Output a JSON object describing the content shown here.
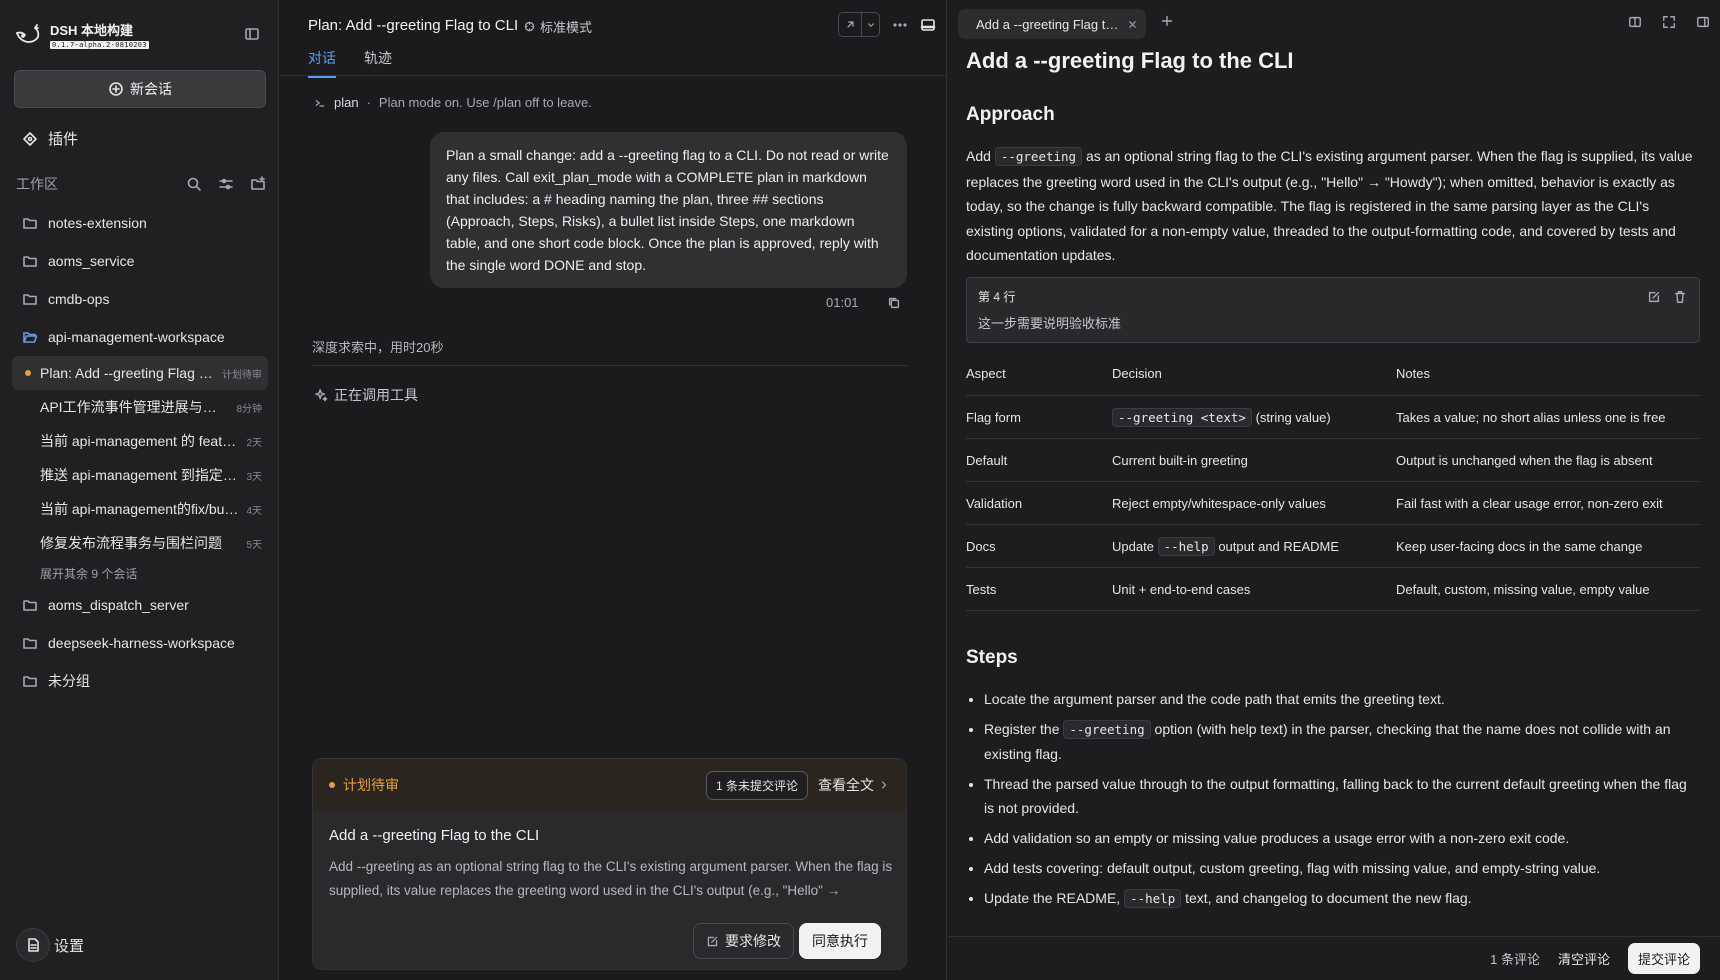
{
  "brand": {
    "name": "DSH 本地构建",
    "version": "0.1.7-alpha.2-0810203"
  },
  "sidebar": {
    "new_chat": "新会话",
    "plugins": "插件",
    "workspace_label": "工作区",
    "folders_top": [
      {
        "name": "notes-extension"
      },
      {
        "name": "aoms_service"
      },
      {
        "name": "cmdb-ops"
      },
      {
        "name": "api-management-workspace"
      }
    ],
    "sessions": [
      {
        "title": "Plan: Add --greeting Flag to CLI",
        "meta": "计划待审"
      },
      {
        "title": "API工作流事件管理进展与后续",
        "meta": "8分钟"
      },
      {
        "title": "当前 api-management 的 feature 分支",
        "meta": "2天"
      },
      {
        "title": "推送 api-management 到指定远程",
        "meta": "3天"
      },
      {
        "title": "当前 api-management的fix/bug分支",
        "meta": "4天"
      },
      {
        "title": "修复发布流程事务与围栏问题",
        "meta": "5天"
      }
    ],
    "expand_more": "展开其余 9 个会话",
    "folders_bottom": [
      {
        "name": "aoms_dispatch_server"
      },
      {
        "name": "deepseek-harness-workspace"
      },
      {
        "name": "未分组"
      }
    ],
    "settings": "设置"
  },
  "center": {
    "title": "Plan: Add --greeting Flag to CLI",
    "mode": "标准模式",
    "tabs": [
      {
        "label": "对话"
      },
      {
        "label": "轨迹"
      }
    ],
    "plan_tag": "plan",
    "plan_note": "Plan mode on. Use /plan off to leave.",
    "user_message": "Plan a small change: add a --greeting flag to a CLI. Do not read or write any files. Call exit_plan_mode with a COMPLETE plan in markdown that includes: a # heading naming the plan, three ## sections (Approach, Steps, Risks), a bullet list inside Steps, one markdown table, and one short code block. Once the plan is approved, reply with the single word DONE and stop.",
    "message_time": "01:01",
    "thinking": "深度求索中，用时20秒",
    "tool_status": "正在调用工具",
    "plan_card": {
      "status": "计划待审",
      "pending_comments": "1 条未提交评论",
      "view_full": "查看全文",
      "title": "Add a --greeting Flag to the CLI",
      "body": "Add --greeting as an optional string flag to the CLI's existing argument parser. When the flag is supplied, its value replaces the greeting word used in the CLI's output (e.g., \"Hello\" → \"Howdy\"); when omitted, behavior is exactly as today.",
      "request_changes": "要求修改",
      "approve": "同意执行"
    }
  },
  "right": {
    "tab_title": "Add a --greeting Flag to the CLI",
    "doc": {
      "h1": "Add a --greeting Flag to the CLI",
      "approach_heading": "Approach",
      "approach_pre": "Add",
      "approach_code": "--greeting",
      "approach_post": "as an optional string flag to the CLI's existing argument parser. When the flag is supplied, its value replaces the greeting word used in the CLI's output (e.g., \"Hello\" → \"Howdy\"); when omitted, behavior is exactly as today, so the change is fully backward compatible. The flag is registered in the same parsing layer as the CLI's existing options, validated for a non-empty value, threaded to the output-formatting code, and covered by tests and documentation updates.",
      "comment": {
        "line": "第 4 行",
        "text": "这一步需要说明验收标准"
      },
      "table": {
        "headers": [
          "Aspect",
          "Decision",
          "Notes"
        ],
        "rows": [
          {
            "aspect": "Flag form",
            "code": "--greeting <text>",
            "decision": "(string value)",
            "notes": "Takes a value; no short alias unless one is free"
          },
          {
            "aspect": "Default",
            "decision": "Current built-in greeting",
            "notes": "Output is unchanged when the flag is absent"
          },
          {
            "aspect": "Validation",
            "decision": "Reject empty/whitespace-only values",
            "notes": "Fail fast with a clear usage error, non-zero exit"
          },
          {
            "aspect": "Docs",
            "pre": "Update",
            "code": "--help",
            "decision": "output and README",
            "notes": "Keep user-facing docs in the same change"
          },
          {
            "aspect": "Tests",
            "decision": "Unit + end-to-end cases",
            "notes": "Default, custom, missing value, empty value"
          }
        ]
      },
      "steps_heading": "Steps",
      "steps": [
        {
          "text": "Locate the argument parser and the code path that emits the greeting text."
        },
        {
          "pre": "Register the",
          "code": "--greeting",
          "text": "option (with help text) in the parser, checking that the name does not collide with an existing flag."
        },
        {
          "text": "Thread the parsed value through to the output formatting, falling back to the current default greeting when the flag is not provided."
        },
        {
          "text": "Add validation so an empty or missing value produces a usage error with a non-zero exit code."
        },
        {
          "text": "Add tests covering: default output, custom greeting, flag with missing value, and empty-string value."
        },
        {
          "pre": "Update the README,",
          "code": "--help",
          "text": "text, and changelog to document the new flag."
        }
      ]
    },
    "footer": {
      "count": "1 条评论",
      "clear": "清空评论",
      "submit": "提交评论"
    }
  },
  "colors": {
    "accent": "#5b9df0",
    "pending": "#e8a13a",
    "folder_open": "#6a9bdc"
  }
}
